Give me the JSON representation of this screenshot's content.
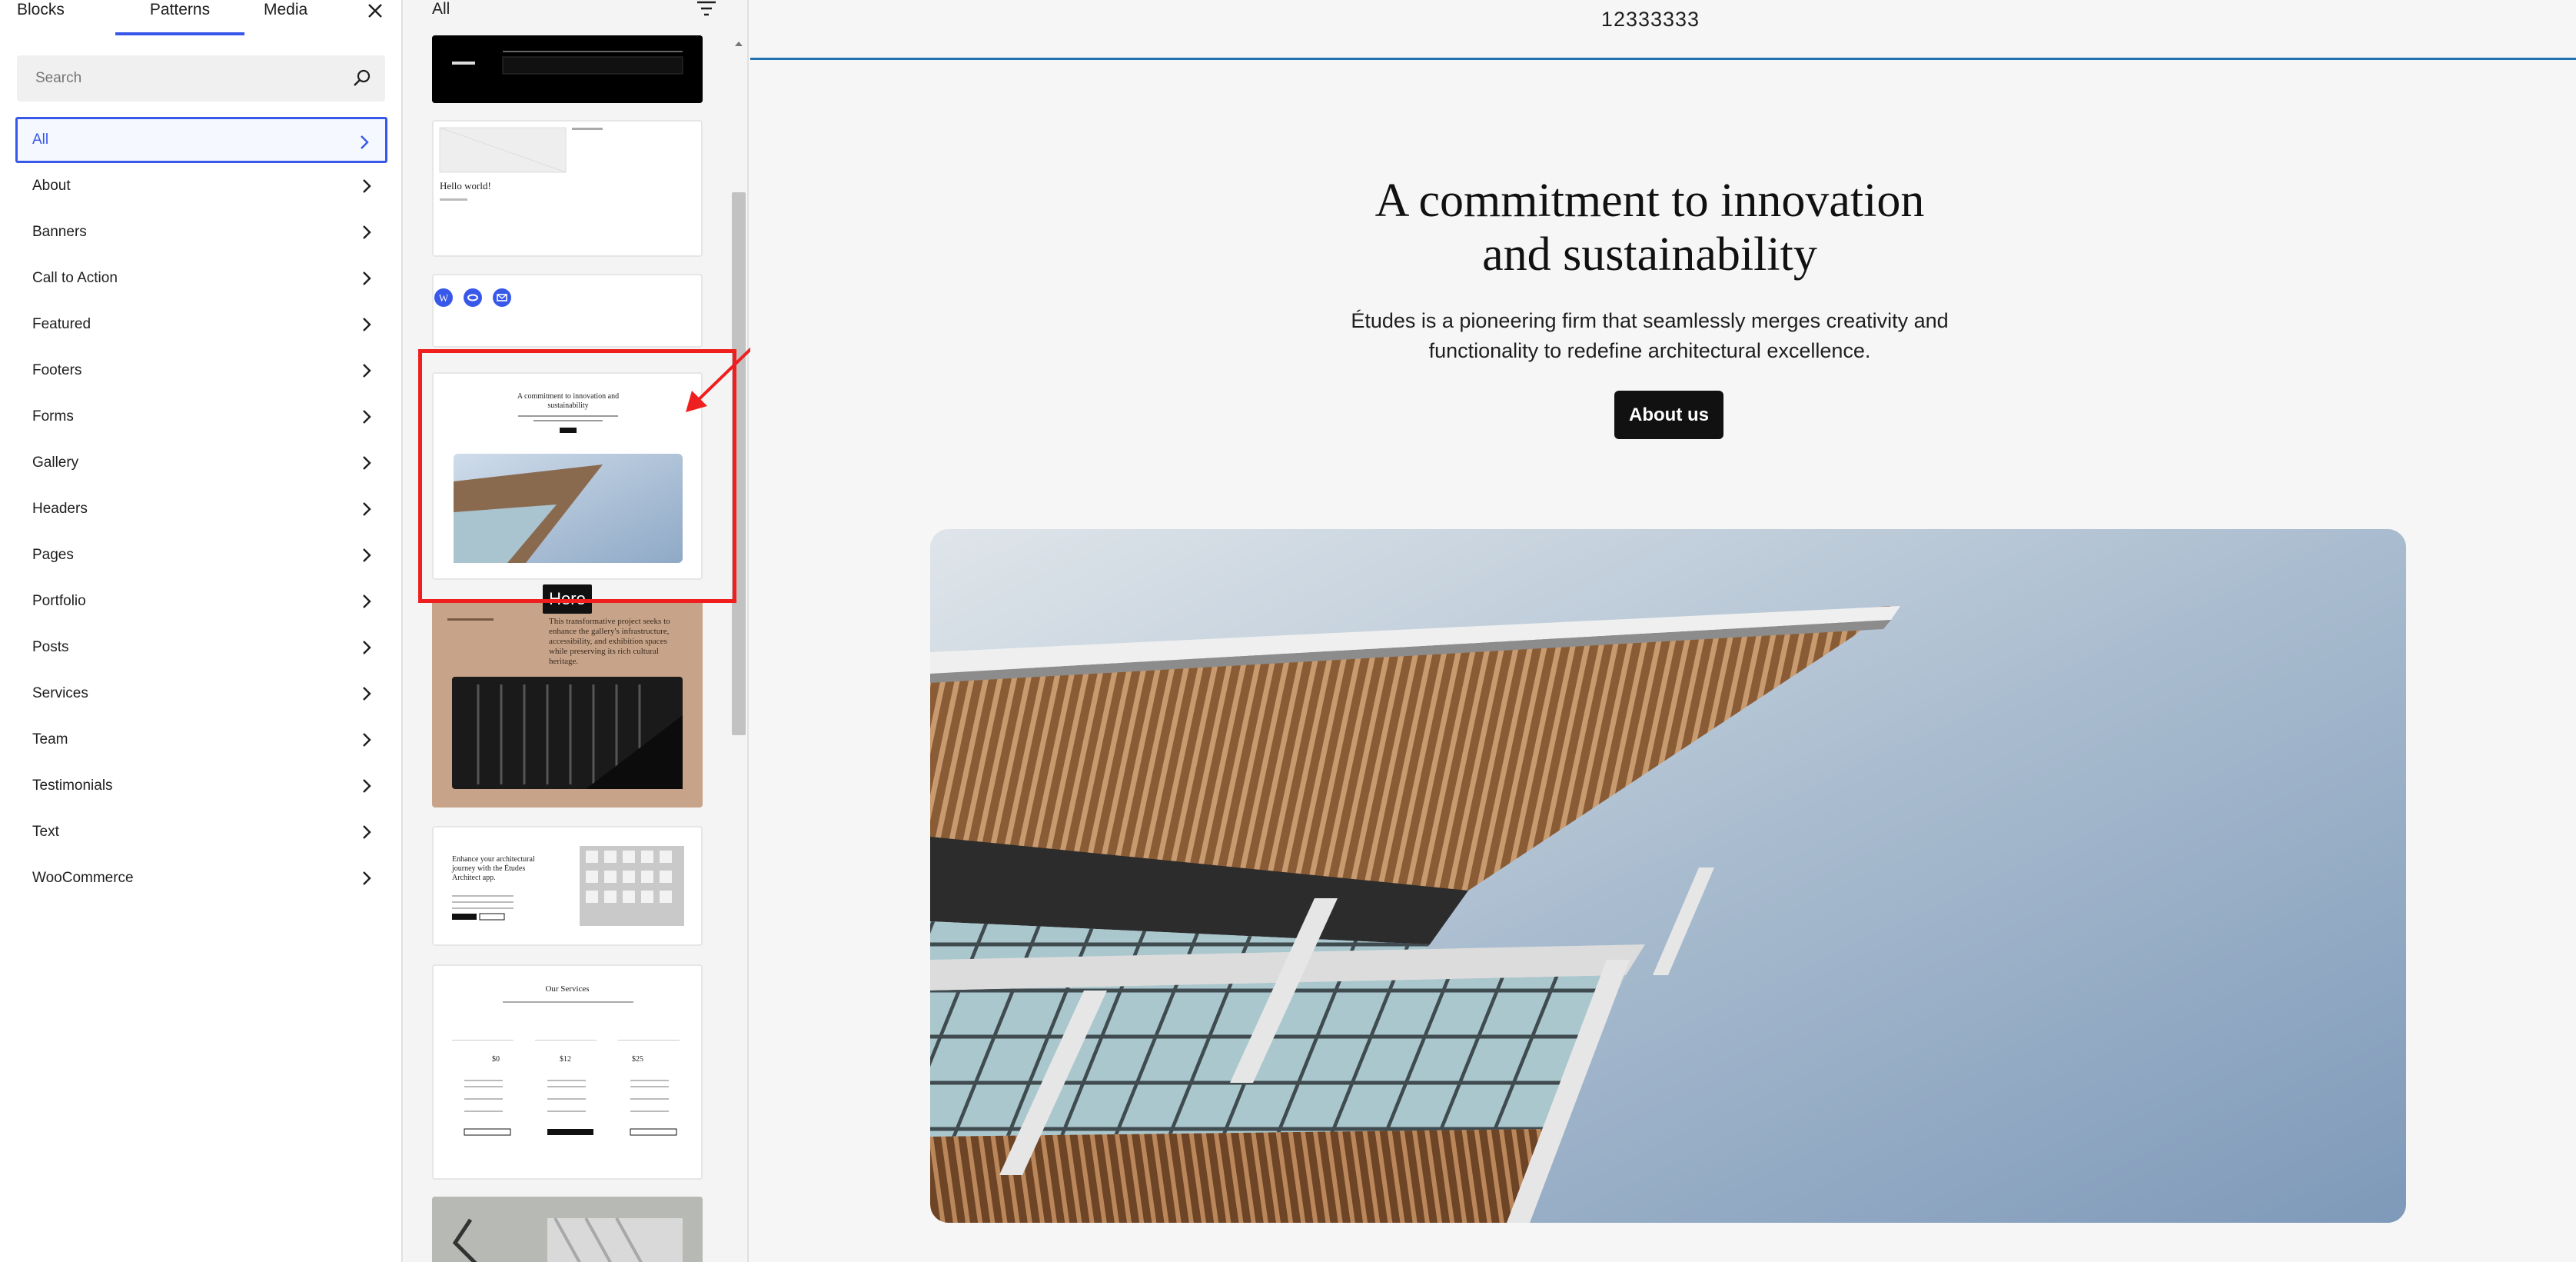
{
  "inserter": {
    "tabs": [
      {
        "label": "Blocks"
      },
      {
        "label": "Patterns"
      },
      {
        "label": "Media"
      }
    ],
    "search_placeholder": "Search",
    "categories": [
      {
        "label": "All"
      },
      {
        "label": "About"
      },
      {
        "label": "Banners"
      },
      {
        "label": "Call to Action"
      },
      {
        "label": "Featured"
      },
      {
        "label": "Footers"
      },
      {
        "label": "Forms"
      },
      {
        "label": "Gallery"
      },
      {
        "label": "Headers"
      },
      {
        "label": "Pages"
      },
      {
        "label": "Portfolio"
      },
      {
        "label": "Posts"
      },
      {
        "label": "Services"
      },
      {
        "label": "Team"
      },
      {
        "label": "Testimonials"
      },
      {
        "label": "Text"
      },
      {
        "label": "WooCommerce"
      }
    ],
    "active_category": "All"
  },
  "patterns": {
    "heading": "All",
    "cards": {
      "c2_title": "Hello world!",
      "c4_heading": "A commitment to innovation and sustainability",
      "c5_text": "This transformative project seeks to enhance the gallery's infrastructure, accessibility, and exhibition spaces while preserving its rich cultural heritage.",
      "c6_heading": "Enhance your architectural journey with the Études Architect app.",
      "c7_heading": "Our Services",
      "c7_prices": [
        "$0",
        "$12",
        "$25"
      ]
    },
    "annotation_label": "Here"
  },
  "canvas": {
    "site_title": "12333333",
    "hero_heading_line1": "A commitment to innovation",
    "hero_heading_line2": "and sustainability",
    "hero_text_line1": "Études is a pioneering firm that seamlessly merges creativity and",
    "hero_text_line2": "functionality to redefine architectural excellence.",
    "button_label": "About us"
  },
  "colors": {
    "accent": "#3858e9",
    "header_line": "#2271b1",
    "annotation": "#f01f1f"
  }
}
